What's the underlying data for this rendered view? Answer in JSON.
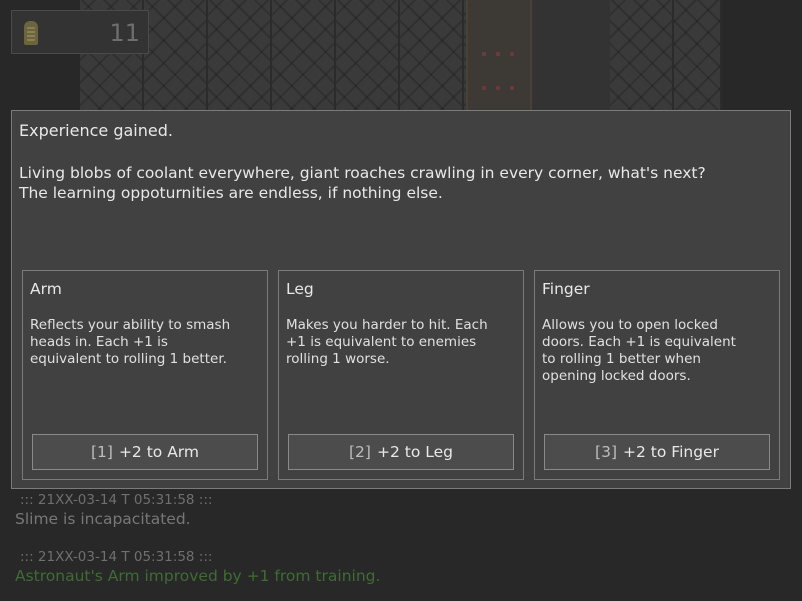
{
  "hud": {
    "icon": "ammo-icon",
    "count": "11"
  },
  "dialog": {
    "title": "Experience gained.",
    "lines": [
      "Living blobs of coolant everywhere, giant roaches crawling in every corner, what's next?",
      "The learning oppoturnities are endless, if nothing else."
    ]
  },
  "cards": [
    {
      "title": "Arm",
      "desc": [
        "Reflects your ability to smash",
        "heads in. Each +1 is",
        "equivalent to rolling 1 better."
      ],
      "key": "[1]",
      "button": "+2 to Arm"
    },
    {
      "title": "Leg",
      "desc": [
        "Makes you harder to hit. Each",
        "+1 is equivalent to enemies",
        "rolling 1 worse."
      ],
      "key": "[2]",
      "button": "+2 to Leg"
    },
    {
      "title": "Finger",
      "desc": [
        "Allows you to open locked",
        "doors. Each +1 is equivalent",
        "to rolling 1 better when",
        "opening locked doors."
      ],
      "key": "[3]",
      "button": "+2 to Finger"
    }
  ],
  "log": [
    {
      "timestamp": "::: 21XX-03-14 T 05:31:58 :::",
      "message": "Slime is incapacitated.",
      "color": "#777777"
    },
    {
      "timestamp": "::: 21XX-03-14 T 05:31:58 :::",
      "message": "Astronaut's Arm improved by +1 from training.",
      "color": "#3f6b35"
    }
  ]
}
